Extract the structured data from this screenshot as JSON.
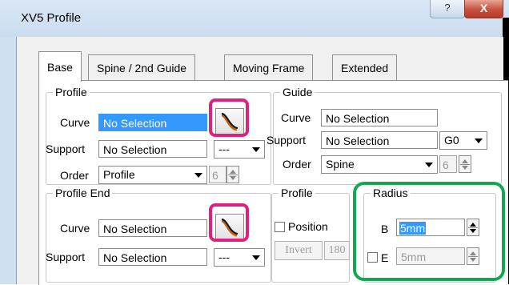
{
  "window": {
    "title": "XV5 Profile",
    "help_label": "?",
    "close_label": "X"
  },
  "tabs": [
    {
      "label": "Base"
    },
    {
      "label": "Spine / 2nd Guide"
    },
    {
      "label": "Moving Frame"
    },
    {
      "label": "Extended"
    }
  ],
  "profile": {
    "legend": "Profile",
    "curve_label": "Curve",
    "curve_value": "No Selection",
    "support_label": "Support",
    "support_value": "No Selection",
    "support_combo": "---",
    "order_label": "Order",
    "order_value": "Profile",
    "order_spin": "6"
  },
  "guide": {
    "legend": "Guide",
    "curve_label": "Curve",
    "curve_value": "No Selection",
    "support_label": "Support",
    "support_value": "No Selection",
    "continuity": "G0",
    "order_label": "Order",
    "order_value": "Spine",
    "order_spin": "6"
  },
  "profile_end": {
    "legend": "Profile End",
    "curve_label": "Curve",
    "curve_value": "No Selection",
    "support_label": "Support",
    "support_value": "No Selection",
    "support_combo": "---"
  },
  "profile_pos": {
    "legend": "Profile",
    "position_label": "Position",
    "invert_label": "Invert",
    "rotate_label": "180"
  },
  "radius": {
    "legend": "Radius",
    "b_label": "B",
    "b_value": "5mm",
    "e_label": "E",
    "e_value": "5mm"
  },
  "colors": {
    "highlight_magenta": "#e0207e",
    "highlight_green": "#12a84d",
    "selection": "#3399ff"
  }
}
